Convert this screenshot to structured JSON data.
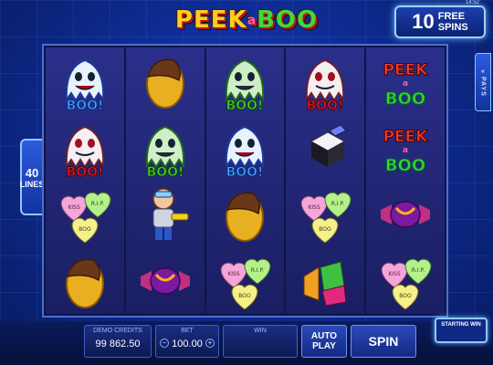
{
  "logo": {
    "peek": "PEEK",
    "a": "a",
    "boo": "BOO"
  },
  "free_spins": {
    "count": "10",
    "line1": "FREE",
    "line2": "SPINS"
  },
  "lines": {
    "count": "40",
    "label": "LINES"
  },
  "pays": {
    "label": "PAYS"
  },
  "credits": {
    "label": "DEMO CREDITS",
    "value": "99 862.50"
  },
  "bet": {
    "label": "BET",
    "value": "100.00",
    "minus": "−",
    "plus": "+"
  },
  "win": {
    "label": "WIN",
    "value": ""
  },
  "buttons": {
    "auto_play": "AUTO PLAY",
    "spin": "SPIN"
  },
  "starting_win": {
    "label": "STARTING WIN"
  },
  "time": "14:52",
  "symbols": {
    "ghost_white": "BOO!",
    "ghost_green": "BOO!",
    "ghost_blue": "BOO!",
    "logo_symbol": "PEEK-a-BOO",
    "hearts": [
      "KISS",
      "R.I.P.",
      "BOO"
    ]
  },
  "reels": [
    [
      "ghost-blue",
      "ghost-white",
      "hearts",
      "chocolate-coin"
    ],
    [
      "chocolate-coin",
      "ghost-green",
      "astronaut-kid",
      "candy-wrapped"
    ],
    [
      "ghost-green",
      "ghost-blue",
      "chocolate-coin",
      "hearts"
    ],
    [
      "ghost-white",
      "licorice-cube",
      "hearts",
      "jelly"
    ],
    [
      "logo-symbol",
      "logo-symbol",
      "candy-wrapped",
      "hearts"
    ]
  ]
}
